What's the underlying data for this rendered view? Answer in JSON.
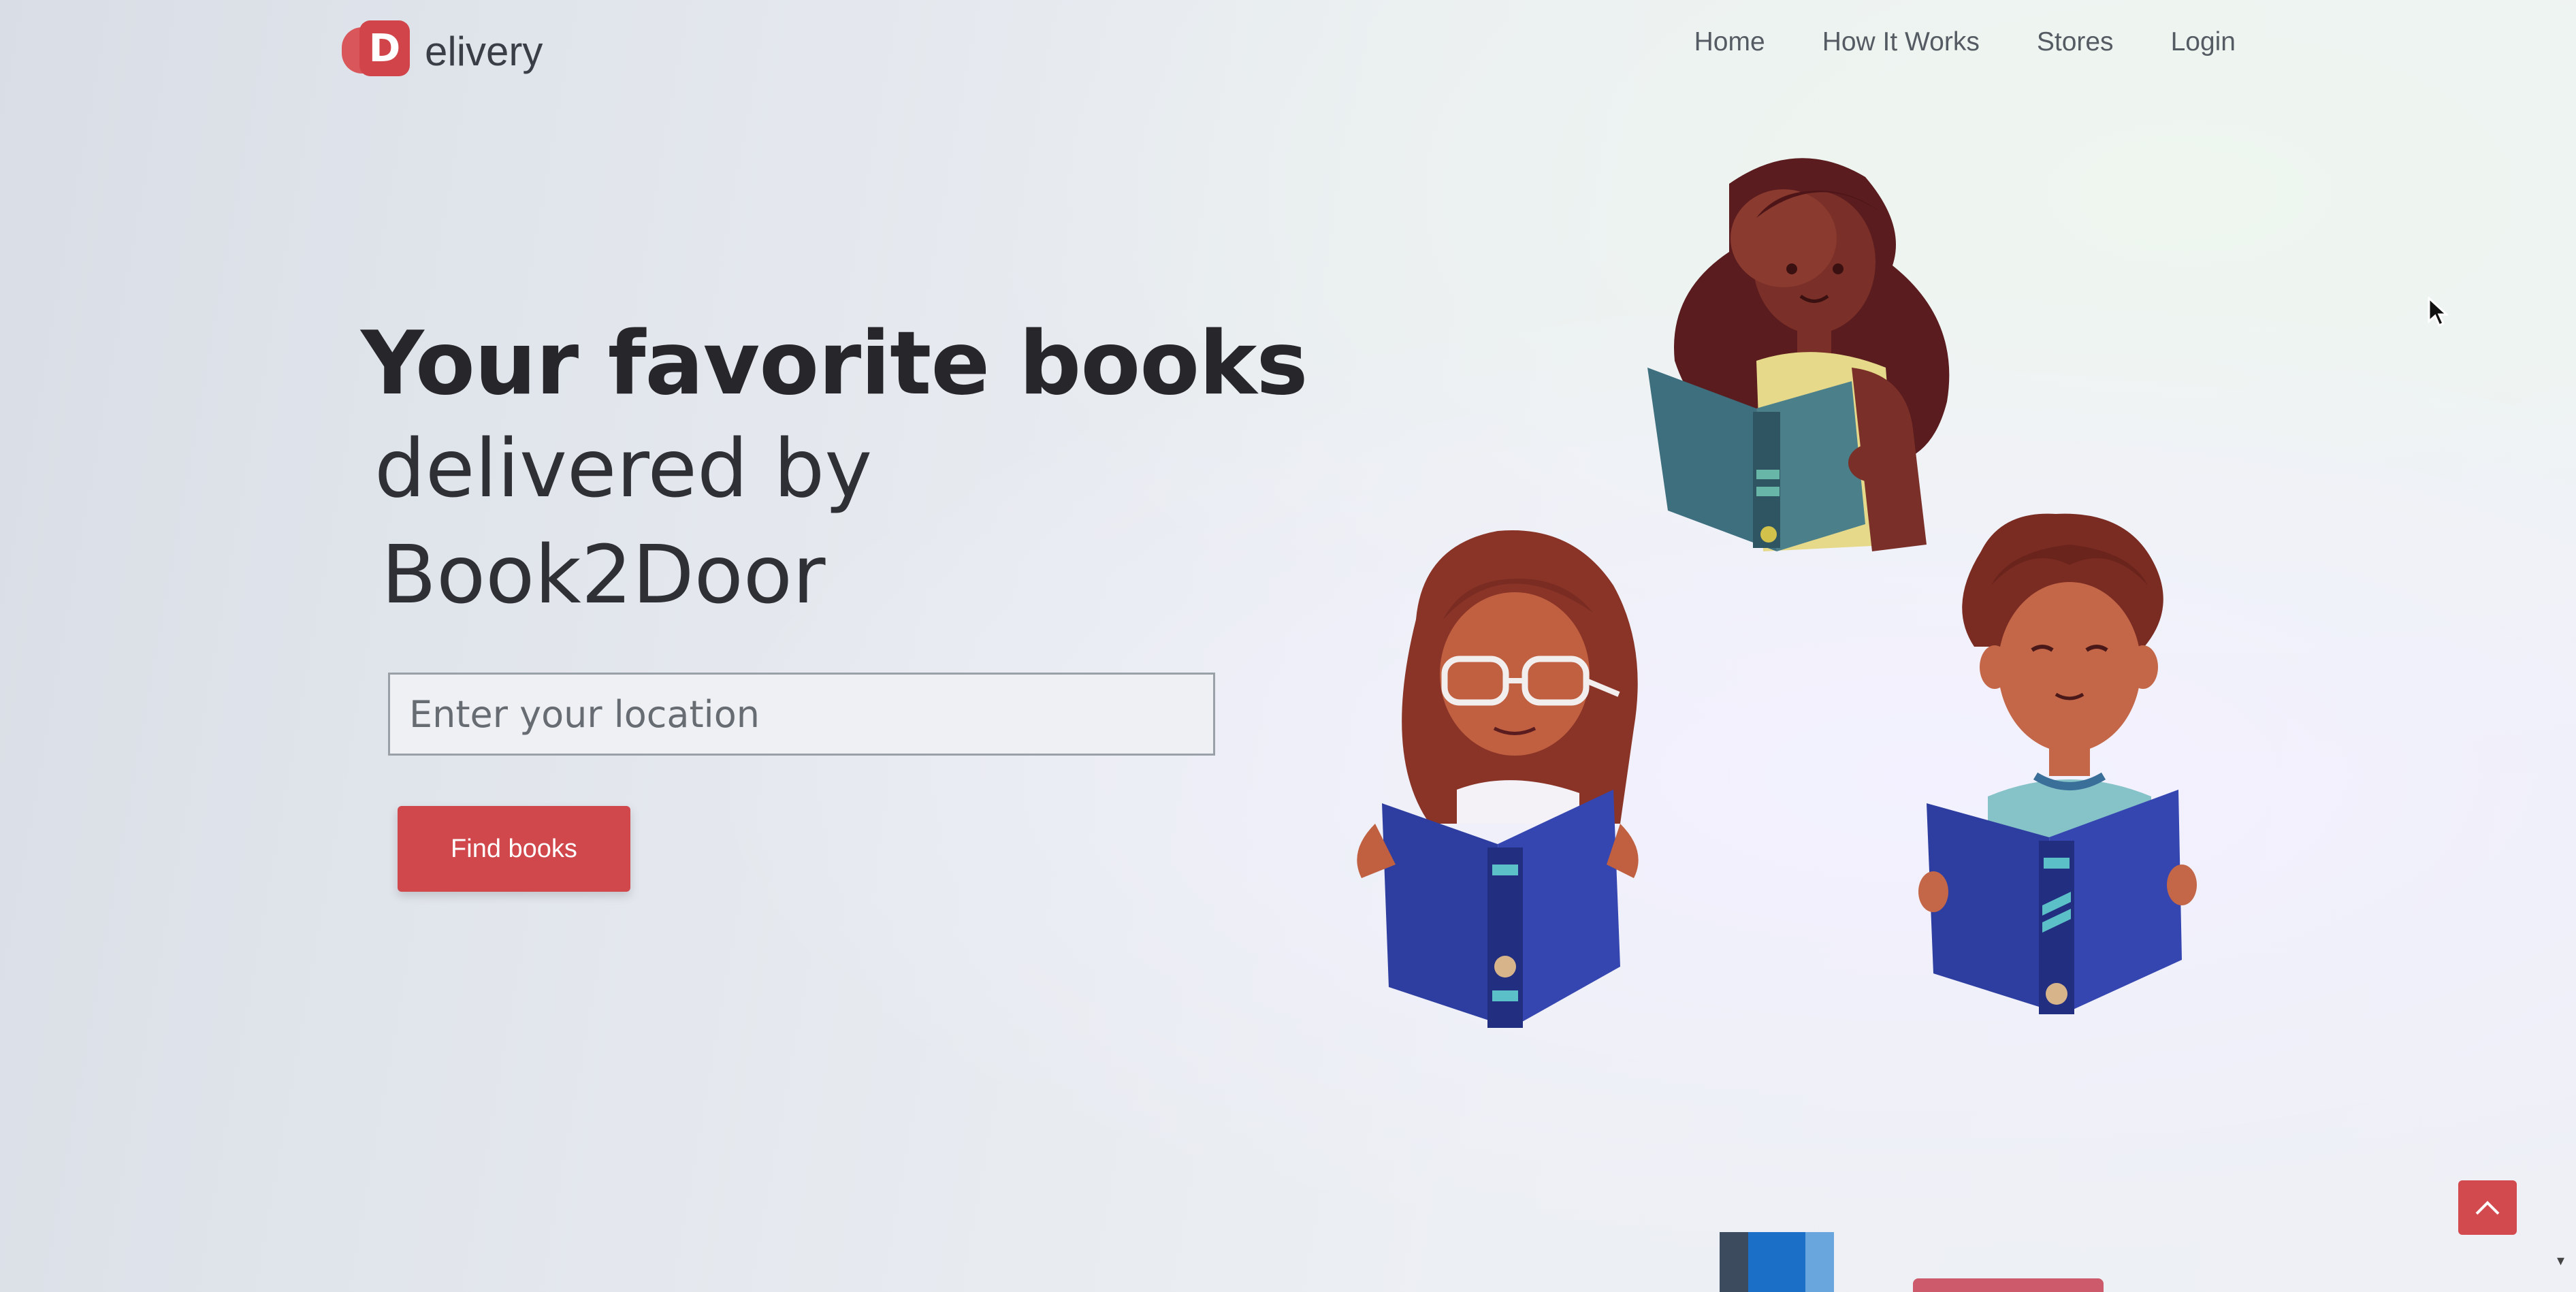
{
  "brand": {
    "logo_letter": "D",
    "logo_suffix": "elivery",
    "accent_color": "#d0444a"
  },
  "nav": {
    "items": [
      "Home",
      "How It Works",
      "Stores",
      "Login"
    ]
  },
  "hero": {
    "title_line1": "Your favorite books",
    "title_line2": "delivered by",
    "title_line3": "Book2Door",
    "location_placeholder": "Enter your location",
    "cta_label": "Find books"
  },
  "icons": {
    "cursor": "mouse-pointer-icon",
    "scroll_top": "chevron-up-icon"
  }
}
